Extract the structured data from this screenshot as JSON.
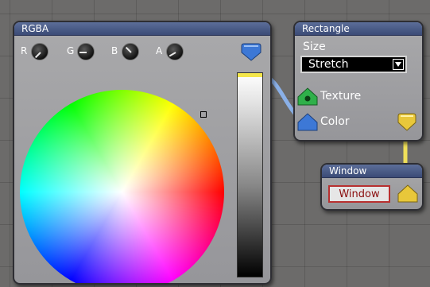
{
  "rgba_node": {
    "title": "RGBA",
    "knobs": [
      {
        "label": "R",
        "icon": "knob-icon"
      },
      {
        "label": "G",
        "icon": "knob-icon"
      },
      {
        "label": "B",
        "icon": "knob-icon"
      },
      {
        "label": "A",
        "icon": "knob-icon"
      }
    ],
    "output_port_color": "#3d78d6"
  },
  "rectangle_node": {
    "title": "Rectangle",
    "size_label": "Size",
    "size_value": "Stretch",
    "inputs": [
      {
        "label": "Texture",
        "color": "#2fb04a",
        "icon": "texture-port-icon"
      },
      {
        "label": "Color",
        "color": "#3d78d6",
        "icon": "color-port-icon"
      }
    ],
    "output_port_color": "#e8c73a"
  },
  "window_node": {
    "title": "Window",
    "button_label": "Window",
    "input_port_color": "#e8c73a"
  },
  "colors": {
    "title_bar": "#4a5b88",
    "node_body": "#a0a0a3",
    "canvas": "#6c6b6a"
  }
}
